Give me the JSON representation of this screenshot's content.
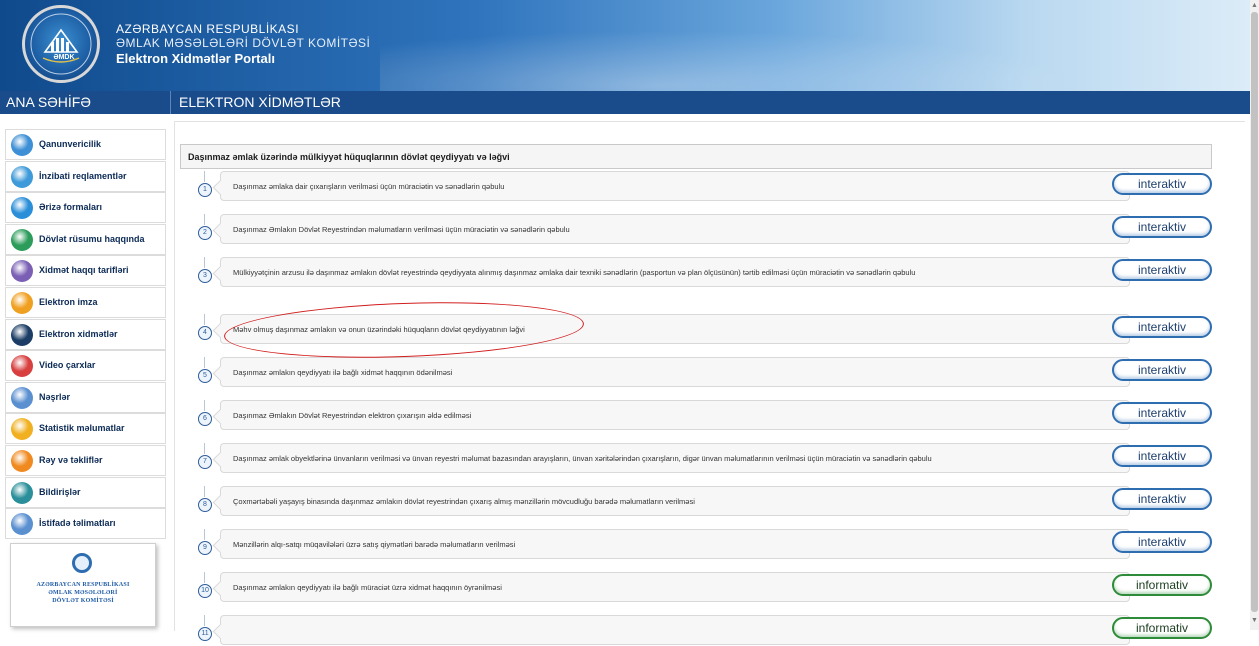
{
  "header": {
    "title_line1": "AZƏRBAYCAN RESPUBLİKASI",
    "title_line2": "ƏMLAK MƏSƏLƏLƏRİ DÖVLƏT KOMİTƏSİ",
    "title_line3": "Elektron Xidmətlər Portalı",
    "emblem_text": "ƏMDK"
  },
  "navbar": {
    "home": "ANA SƏHİFƏ",
    "section": "ELEKTRON XİDMƏTLƏR"
  },
  "sidebar": {
    "items": [
      {
        "label": "Qanunvericilik",
        "icon": "law-icon",
        "color": "#3d8fd6"
      },
      {
        "label": "İnzibati reqlamentlər",
        "icon": "settings-icon",
        "color": "#3e9ad9"
      },
      {
        "label": "Ərizə formaları",
        "icon": "form-icon",
        "color": "#2a8fd8"
      },
      {
        "label": "Dövlət rüsumu haqqında",
        "icon": "fee-icon",
        "color": "#2b9c5a"
      },
      {
        "label": "Xidmət haqqı tarifləri",
        "icon": "tariff-icon",
        "color": "#7a5fb5"
      },
      {
        "label": "Elektron imza",
        "icon": "signature-icon",
        "color": "#f0a020"
      },
      {
        "label": "Elektron xidmətlər",
        "icon": "services-icon",
        "color": "#1b3d66"
      },
      {
        "label": "Video çarxlar",
        "icon": "video-icon",
        "color": "#d84040"
      },
      {
        "label": "Nəşrlər",
        "icon": "publications-icon",
        "color": "#5a8fd0"
      },
      {
        "label": "Statistik məlumatlar",
        "icon": "statistics-icon",
        "color": "#f0b020"
      },
      {
        "label": "Rəy və təkliflər",
        "icon": "feedback-icon",
        "color": "#f08a20"
      },
      {
        "label": "Bildirişlər",
        "icon": "notifications-icon",
        "color": "#2a8f9a"
      },
      {
        "label": "İstifadə təlimatları",
        "icon": "manual-icon",
        "color": "#5a8fd0"
      }
    ],
    "logo_line1": "AZƏRBAYCAN RESPUBLİKASI",
    "logo_line2": "ƏMLAK MƏSƏLƏLƏRİ",
    "logo_line3": "DÖVLƏT KOMİTƏSİ"
  },
  "main": {
    "section_title": "Daşınmaz əmlak üzərində mülkiyyət hüquqlarının dövlət qeydiyyatı və ləğvi",
    "services": [
      {
        "num": "1",
        "text": "Daşınmaz əmlaka dair çıxarışların verilməsi üçün müraciətin və sənədlərin qəbulu",
        "type": "interaktiv"
      },
      {
        "num": "2",
        "text": "Daşınmaz Əmlakın Dövlət Reyestrindən məlumatların verilməsi üçün müraciətin və sənədlərin qəbulu",
        "type": "interaktiv"
      },
      {
        "num": "3",
        "text": "Mülkiyyətçinin arzusu ilə daşınmaz əmlakın dövlət reyestrində qeydiyyata alınmış daşınmaz əmlaka dair texniki sənədlərin (pasportun və plan ölçüsünün) tərtib edilməsi üçün müraciətin və sənədlərin qəbulu",
        "type": "interaktiv"
      },
      {
        "num": "4",
        "text": "Məhv olmuş daşınmaz əmlakın və onun üzərindəki hüquqların dövlət qeydiyyatının ləğvi",
        "type": "interaktiv"
      },
      {
        "num": "5",
        "text": "Daşınmaz əmlakın qeydiyyatı ilə bağlı xidmət haqqının ödənilməsi",
        "type": "interaktiv"
      },
      {
        "num": "6",
        "text": "Daşınmaz Əmlakın Dövlət Reyestrindən elektron çıxarışın əldə edilməsi",
        "type": "interaktiv"
      },
      {
        "num": "7",
        "text": "Daşınmaz əmlak obyektlərinə ünvanların verilməsi və ünvan reyestri məlumat bazasından arayışların, ünvan xəritələrindən çıxarışların, digər ünvan məlumatlarının verilməsi üçün müraciətin və sənədlərin qəbulu",
        "type": "interaktiv"
      },
      {
        "num": "8",
        "text": "Çoxmərtəbəli yaşayış binasında daşınmaz əmlakın dövlət reyestrindən çıxarış almış mənzillərin mövcudluğu barədə məlumatların verilməsi",
        "type": "interaktiv"
      },
      {
        "num": "9",
        "text": "Mənzillərin alqı-satqı müqavilələri üzrə satış qiymətləri barədə məlumatların verilməsi",
        "type": "interaktiv"
      },
      {
        "num": "10",
        "text": "Daşınmaz əmlakın qeydiyyatı ilə bağlı müraciət üzrə xidmət haqqının öyrənilməsi",
        "type": "informativ"
      },
      {
        "num": "11",
        "text": "",
        "type": "informativ"
      }
    ]
  },
  "colors": {
    "nav_bg": "#1a4b8a",
    "interactive_border": "#2f6db1",
    "informative_border": "#2e8b3a",
    "annotation": "#d11d1d"
  }
}
